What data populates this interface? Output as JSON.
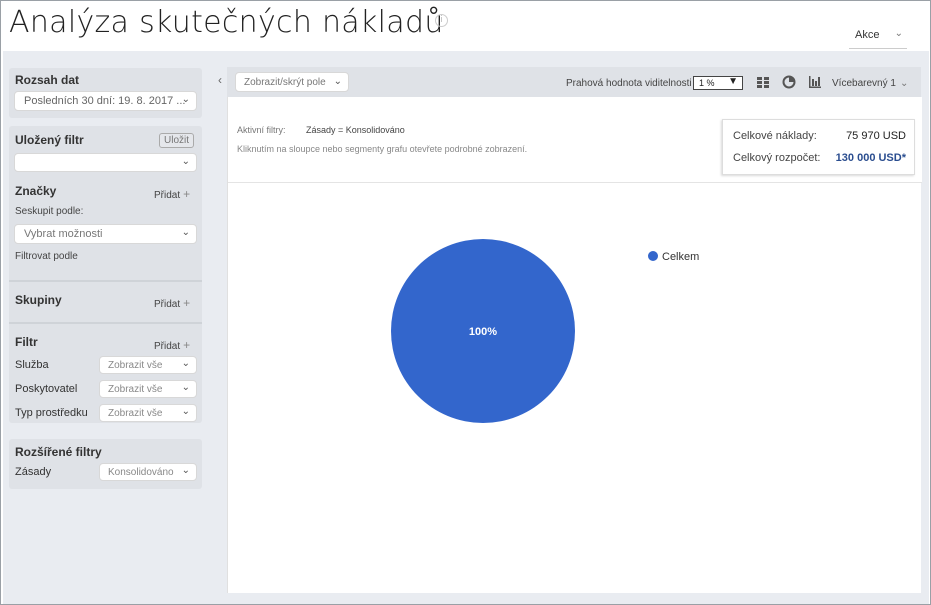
{
  "header": {
    "title": "Analýza skutečných nákladů",
    "info_icon": "info-icon",
    "actions_label": "Akce"
  },
  "sidebar": {
    "date_range": {
      "title": "Rozsah dat",
      "value": "Posledních 30 dní: 19. 8. 2017 ..."
    },
    "saved_filter": {
      "title": "Uložený filtr",
      "save_label": "Uložit",
      "value": ""
    },
    "tags": {
      "title": "Značky",
      "add_label": "Přidat",
      "group_by_label": "Seskupit podle:",
      "group_by_placeholder": "Vybrat možnosti",
      "filter_by_label": "Filtrovat podle"
    },
    "groups": {
      "title": "Skupiny",
      "add_label": "Přidat"
    },
    "filter": {
      "title": "Filtr",
      "add_label": "Přidat",
      "rows": [
        {
          "label": "Služba",
          "value": "Zobrazit vše"
        },
        {
          "label": "Poskytovatel",
          "value": "Zobrazit vše"
        },
        {
          "label": "Typ prostředku",
          "value": "Zobrazit vše"
        }
      ]
    },
    "advanced": {
      "title": "Rozšířené filtry",
      "rows": [
        {
          "label": "Zásady",
          "value": "Konsolidováno"
        }
      ]
    }
  },
  "toolbar": {
    "toggle_fields": "Zobrazit/skrýt pole",
    "threshold_label": "Prahová hodnota viditelnosti",
    "threshold_value": "1 %",
    "icons": [
      "grid-view-icon",
      "pie-chart-icon",
      "bar-chart-icon"
    ],
    "color_mode": "Vícebarevný 1"
  },
  "active_filters": {
    "label": "Aktivní filtry:",
    "value": "Zásady = Konsolidováno",
    "hint": "Kliknutím na sloupce nebo segmenty grafu otevřete podrobné zobrazení."
  },
  "totals": {
    "total_cost_label": "Celkové náklady:",
    "total_cost_value": "75 970 USD",
    "total_budget_label": "Celkový rozpočet:",
    "total_budget_value": "130 000 USD*"
  },
  "chart_data": {
    "type": "pie",
    "categories": [
      "Celkem"
    ],
    "values": [
      100
    ],
    "data_labels": [
      "100%"
    ],
    "colors": [
      "#3366cc"
    ],
    "legend_position": "top-right"
  }
}
